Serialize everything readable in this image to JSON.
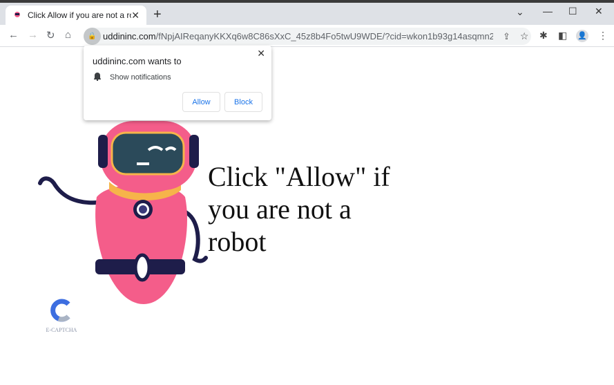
{
  "browser": {
    "tab_title": "Click Allow if you are not a robot",
    "url_domain": "uddininc.com",
    "url_path": "/fNpjAIReqanyKKXq6w8C86sXxC_45z8b4Fo5twU9WDE/?cid=wkon1b93g14asqmn23t804bo..."
  },
  "popup": {
    "title": "uddininc.com wants to",
    "permission": "Show notifications",
    "allow_label": "Allow",
    "block_label": "Block"
  },
  "page": {
    "message": "Click \"Allow\" if you are not a robot",
    "logo_text": "E-CAPTCHA"
  },
  "colors": {
    "robot_pink": "#f45d8a",
    "robot_navy": "#1e1d4a",
    "accent": "#1a73e8"
  }
}
